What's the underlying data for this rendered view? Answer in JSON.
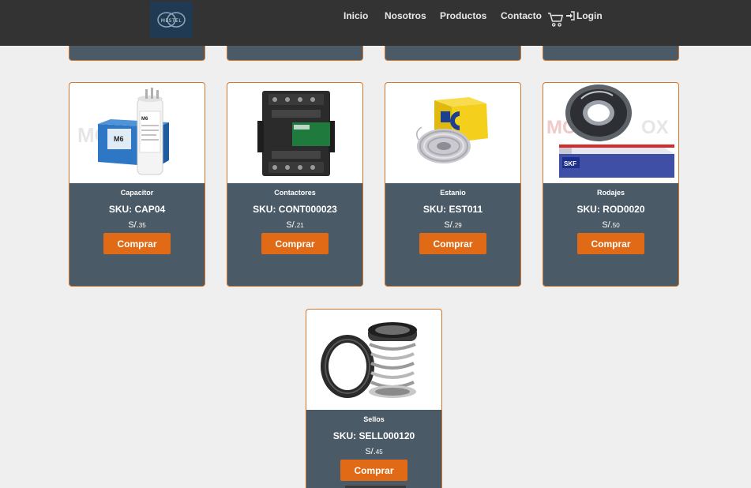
{
  "nav": {
    "logo_text": "MESTEL",
    "links": [
      "Inicio",
      "Nosotros",
      "Productos",
      "Contacto"
    ],
    "cart_icon": "cart-icon",
    "login_label": "Login",
    "login_icon": "sign-in-icon"
  },
  "colors": {
    "header": "#333333",
    "card_bg": "#4b5a67",
    "card_border": "#d4762a",
    "button": "#e06a16",
    "page_bg": "#efefef"
  },
  "products": [
    {
      "name": "Capacitor",
      "sku": "SKU: CAP04",
      "currency": "S/.",
      "price": "35",
      "button": "Comprar",
      "image": "capacitor-image"
    },
    {
      "name": "Contactores",
      "sku": "SKU: CONT000023",
      "currency": "S/.",
      "price": "21",
      "button": "Comprar",
      "image": "contactor-image"
    },
    {
      "name": "Estanio",
      "sku": "SKU: EST011",
      "currency": "S/.",
      "price": "29",
      "button": "Comprar",
      "image": "solder-wire-image"
    },
    {
      "name": "Rodajes",
      "sku": "SKU: ROD0020",
      "currency": "S/.",
      "price": "50",
      "button": "Comprar",
      "image": "bearing-image"
    },
    {
      "name": "Sellos",
      "sku": "SKU: SELL000120",
      "currency": "S/.",
      "price": "45",
      "button": "Comprar",
      "image": "mechanical-seal-image"
    }
  ]
}
